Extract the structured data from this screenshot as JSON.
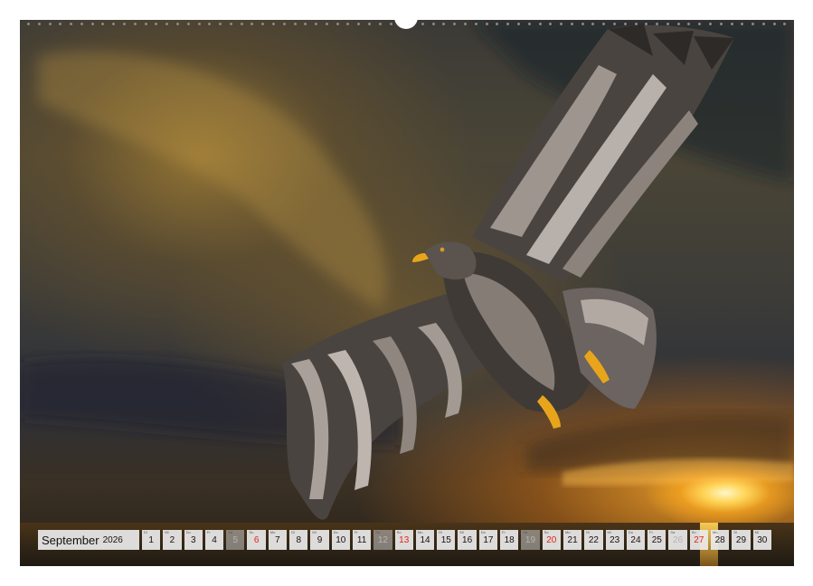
{
  "calendar": {
    "month": "September",
    "year": "2026",
    "days": [
      {
        "wd": "Di",
        "n": "1",
        "kind": "week"
      },
      {
        "wd": "Mi",
        "n": "2",
        "kind": "week"
      },
      {
        "wd": "Do",
        "n": "3",
        "kind": "week"
      },
      {
        "wd": "Fr",
        "n": "4",
        "kind": "week"
      },
      {
        "wd": "Sa",
        "n": "5",
        "kind": "sat"
      },
      {
        "wd": "So",
        "n": "6",
        "kind": "sun"
      },
      {
        "wd": "Mo",
        "n": "7",
        "kind": "week"
      },
      {
        "wd": "Di",
        "n": "8",
        "kind": "week"
      },
      {
        "wd": "Mi",
        "n": "9",
        "kind": "week"
      },
      {
        "wd": "Do",
        "n": "10",
        "kind": "week"
      },
      {
        "wd": "Fr",
        "n": "11",
        "kind": "week"
      },
      {
        "wd": "Sa",
        "n": "12",
        "kind": "sat"
      },
      {
        "wd": "So",
        "n": "13",
        "kind": "sun"
      },
      {
        "wd": "Mo",
        "n": "14",
        "kind": "week"
      },
      {
        "wd": "Di",
        "n": "15",
        "kind": "week"
      },
      {
        "wd": "Mi",
        "n": "16",
        "kind": "week"
      },
      {
        "wd": "Do",
        "n": "17",
        "kind": "week"
      },
      {
        "wd": "Fr",
        "n": "18",
        "kind": "week"
      },
      {
        "wd": "Sa",
        "n": "19",
        "kind": "sat"
      },
      {
        "wd": "So",
        "n": "20",
        "kind": "sun"
      },
      {
        "wd": "Mo",
        "n": "21",
        "kind": "week"
      },
      {
        "wd": "Di",
        "n": "22",
        "kind": "week"
      },
      {
        "wd": "Mi",
        "n": "23",
        "kind": "week"
      },
      {
        "wd": "Do",
        "n": "24",
        "kind": "week"
      },
      {
        "wd": "Fr",
        "n": "25",
        "kind": "week"
      },
      {
        "wd": "Sa",
        "n": "26",
        "kind": "sat"
      },
      {
        "wd": "So",
        "n": "27",
        "kind": "sun"
      },
      {
        "wd": "Mo",
        "n": "28",
        "kind": "week"
      },
      {
        "wd": "Di",
        "n": "29",
        "kind": "week"
      },
      {
        "wd": "Mi",
        "n": "30",
        "kind": "week"
      }
    ]
  },
  "photo": {
    "subject": "eagle-in-flight",
    "colors": {
      "sky_dark": "#2e3138",
      "sky_gold": "#aa8230",
      "sun": "#ffd65a",
      "feather_dark": "#3a3532",
      "feather_light": "#b8b0aa",
      "beak_feet": "#e8a51c"
    }
  },
  "binding": {
    "hole_count": 72
  }
}
